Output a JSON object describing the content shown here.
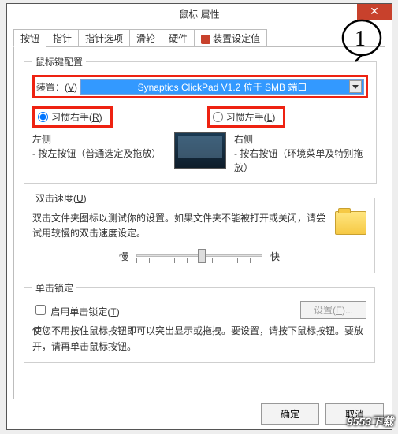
{
  "window": {
    "title": "鼠标 属性",
    "close_glyph": "✕"
  },
  "tabs": [
    {
      "label": "按钮"
    },
    {
      "label": "指针"
    },
    {
      "label": "指针选项"
    },
    {
      "label": "滑轮"
    },
    {
      "label": "硬件"
    },
    {
      "label": "装置设定值"
    }
  ],
  "groups": {
    "config": {
      "legend": "鼠标键配置",
      "device_label": "装置：(V)",
      "device_value": "Synaptics ClickPad V1.2 位于 SMB 端口",
      "radio_right": "习惯右手(R)",
      "radio_left": "习惯左手(L)",
      "left_col_title": "左侧",
      "left_col_desc": "- 按左按钮（普通选定及拖放）",
      "right_col_title": "右侧",
      "right_col_desc": "- 按右按钮（环境菜单及特别拖放）"
    },
    "dblclick": {
      "legend": "双击速度(U)",
      "desc": "双击文件夹图标以测试你的设置。如果文件夹不能被打开或关闭，请尝试用较慢的双击速度设定。",
      "slow": "慢",
      "fast": "快"
    },
    "clicklock": {
      "legend": "单击锁定",
      "checkbox": "启用单击锁定(T)",
      "settings_btn": "设置(E)...",
      "desc": "使您不用按住鼠标按钮即可以突出显示或拖拽。要设置，请按下鼠标按钮。要放开，请再单击鼠标按钮。"
    }
  },
  "buttons": {
    "ok": "确定",
    "cancel": "取消"
  },
  "annotation": {
    "number": "1"
  },
  "watermark": "9553下载"
}
